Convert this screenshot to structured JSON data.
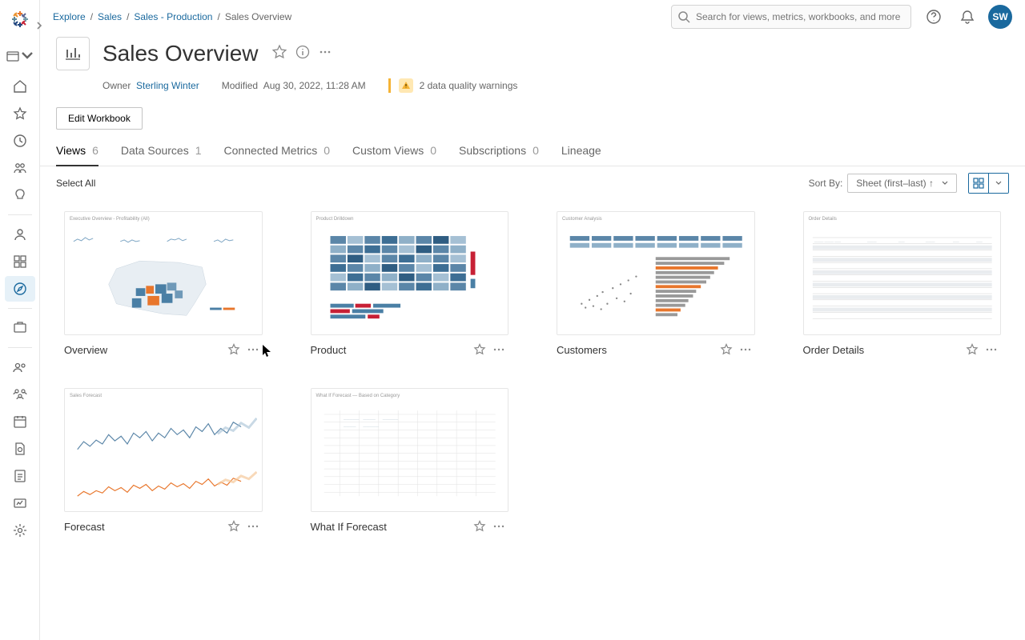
{
  "search": {
    "placeholder": "Search for views, metrics, workbooks, and more"
  },
  "avatar": "SW",
  "breadcrumbs": [
    "Explore",
    "Sales",
    "Sales - Production",
    "Sales Overview"
  ],
  "workbook": {
    "title": "Sales Overview",
    "ownerLabel": "Owner",
    "owner": "Sterling Winter",
    "modifiedLabel": "Modified",
    "modified": "Aug 30, 2022, 11:28 AM",
    "dq": "2 data quality warnings",
    "editBtn": "Edit Workbook"
  },
  "tabs": [
    {
      "label": "Views",
      "count": "6"
    },
    {
      "label": "Data Sources",
      "count": "1"
    },
    {
      "label": "Connected Metrics",
      "count": "0"
    },
    {
      "label": "Custom Views",
      "count": "0"
    },
    {
      "label": "Subscriptions",
      "count": "0"
    },
    {
      "label": "Lineage",
      "count": ""
    }
  ],
  "subbar": {
    "selectAll": "Select All",
    "sortBy": "Sort By:",
    "sortValue": "Sheet (first–last) ↑"
  },
  "views": [
    {
      "name": "Overview"
    },
    {
      "name": "Product"
    },
    {
      "name": "Customers"
    },
    {
      "name": "Order Details"
    },
    {
      "name": "Forecast"
    },
    {
      "name": "What If Forecast"
    }
  ]
}
